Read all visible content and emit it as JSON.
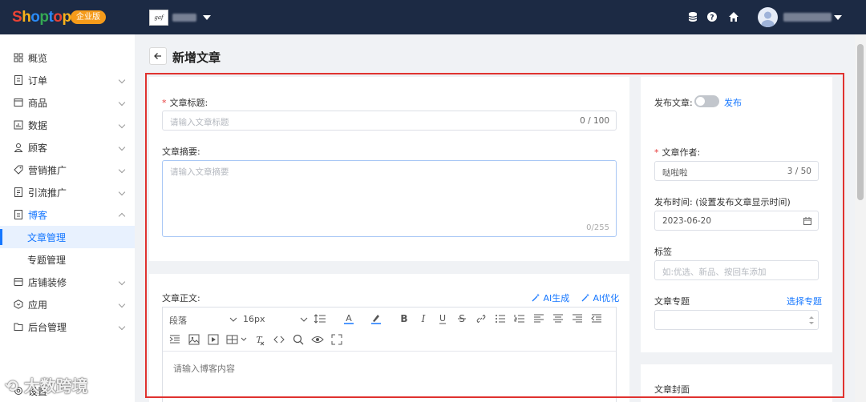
{
  "app": {
    "logo_text": "Shoptop",
    "edition_badge": "企业版",
    "store_logo_text": "gaf",
    "colors": {
      "topbar": "#1c2a44",
      "accent": "#1677ff",
      "highlight_frame": "#e0322f",
      "badge": "#f59b1a"
    }
  },
  "sidebar": {
    "items": [
      {
        "label": "概览",
        "icon": "dashboard-icon"
      },
      {
        "label": "订单",
        "icon": "order-icon"
      },
      {
        "label": "商品",
        "icon": "product-icon"
      },
      {
        "label": "数据",
        "icon": "chart-icon"
      },
      {
        "label": "顾客",
        "icon": "user-icon"
      },
      {
        "label": "营销推广",
        "icon": "tag-icon"
      },
      {
        "label": "引流推广",
        "icon": "document-icon"
      },
      {
        "label": "博客",
        "icon": "blog-icon"
      },
      {
        "label": "店铺装修",
        "icon": "store-icon"
      },
      {
        "label": "应用",
        "icon": "app-icon"
      },
      {
        "label": "后台管理",
        "icon": "folder-icon"
      },
      {
        "label": "设置",
        "icon": "settings-icon"
      }
    ],
    "blog_subitems": [
      {
        "label": "文章管理",
        "active": true
      },
      {
        "label": "专题管理",
        "active": false
      }
    ]
  },
  "page": {
    "title": "新增文章",
    "back_icon": "arrow-left-icon"
  },
  "form": {
    "title_label": "文章标题:",
    "title_placeholder": "请输入文章标题",
    "title_counter": "0 / 100",
    "summary_label": "文章摘要:",
    "summary_placeholder": "请输入文章摘要",
    "summary_counter": "0/255",
    "body_label": "文章正文:",
    "ai_generate": "AI生成",
    "ai_optimize": "AI优化",
    "editor_paragraph": "段落",
    "editor_font_size": "16px",
    "editor_placeholder": "请输入博客内容",
    "publish_label": "发布文章:",
    "publish_link": "发布",
    "publish_on": false,
    "author_label": "文章作者:",
    "author_value": "哒啦啦",
    "author_counter": "3 / 50",
    "publish_time_label": "发布时间:",
    "publish_time_hint": "(设置发布文章显示时间)",
    "publish_time_value": "2023-06-20",
    "tags_label": "标签",
    "tags_placeholder": "如:优选、新品、按回车添加",
    "topic_label": "文章专题",
    "topic_link": "选择专题",
    "cover_label": "文章封面"
  },
  "watermark": "大数跨境"
}
